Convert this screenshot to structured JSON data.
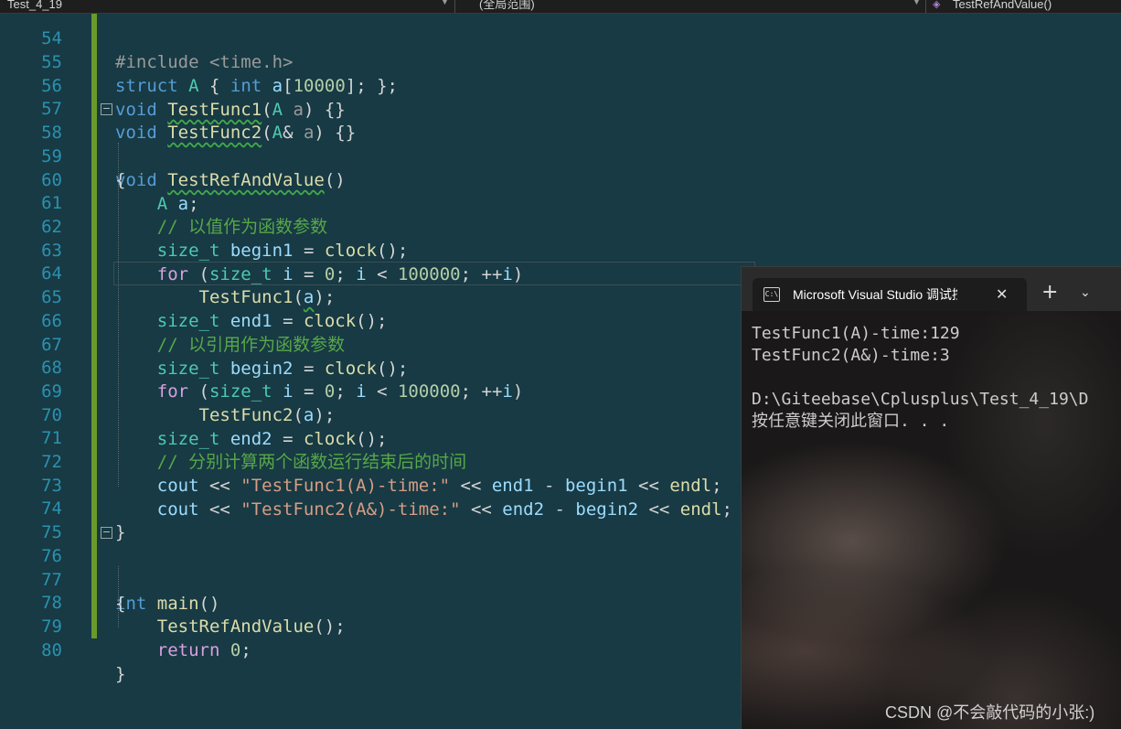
{
  "navbar": {
    "project": "Test_4_19",
    "scope": "(全局范围)",
    "member": "TestRefAndValue()"
  },
  "editor": {
    "line_numbers": [
      "54",
      "55",
      "56",
      "57",
      "58",
      "59",
      "60",
      "61",
      "62",
      "63",
      "64",
      "65",
      "66",
      "67",
      "68",
      "69",
      "70",
      "71",
      "72",
      "73",
      "74",
      "75",
      "76",
      "77",
      "78",
      "79",
      "80"
    ],
    "line54": "#include <time.h>",
    "comments": {
      "c1": "// 以值作为函数参数",
      "c2": "// 以引用作为函数参数",
      "c3": "// 分别计算两个函数运行结束后的时间"
    },
    "strings": {
      "s1": "\"TestFunc1(A)-time:\"",
      "s2": "\"TestFunc2(A&)-time:\""
    },
    "numbers": {
      "arr_size": "10000",
      "zero": "0",
      "loop_count": "100000"
    }
  },
  "console": {
    "tab_title": "Microsoft Visual Studio 调试控制台",
    "close_symbol": "✕",
    "add_symbol": "+",
    "menu_symbol": "⌄",
    "lines": [
      "TestFunc1(A)-time:129",
      "TestFunc2(A&)-time:3",
      "",
      "D:\\Giteebase\\Cplusplus\\Test_4_19\\D",
      "按任意键关闭此窗口. . ."
    ]
  },
  "watermark": "CSDN @不会敲代码的小张:)",
  "colors": {
    "editor_bg": "#173a44",
    "keyword": "#569cd6",
    "control_keyword": "#d8a0df",
    "type": "#4ec9b0",
    "function": "#dcdcaa",
    "variable": "#9cdcfe",
    "number": "#b5cea8",
    "string": "#d69d85",
    "comment": "#57a64a",
    "line_number": "#2b91af"
  }
}
